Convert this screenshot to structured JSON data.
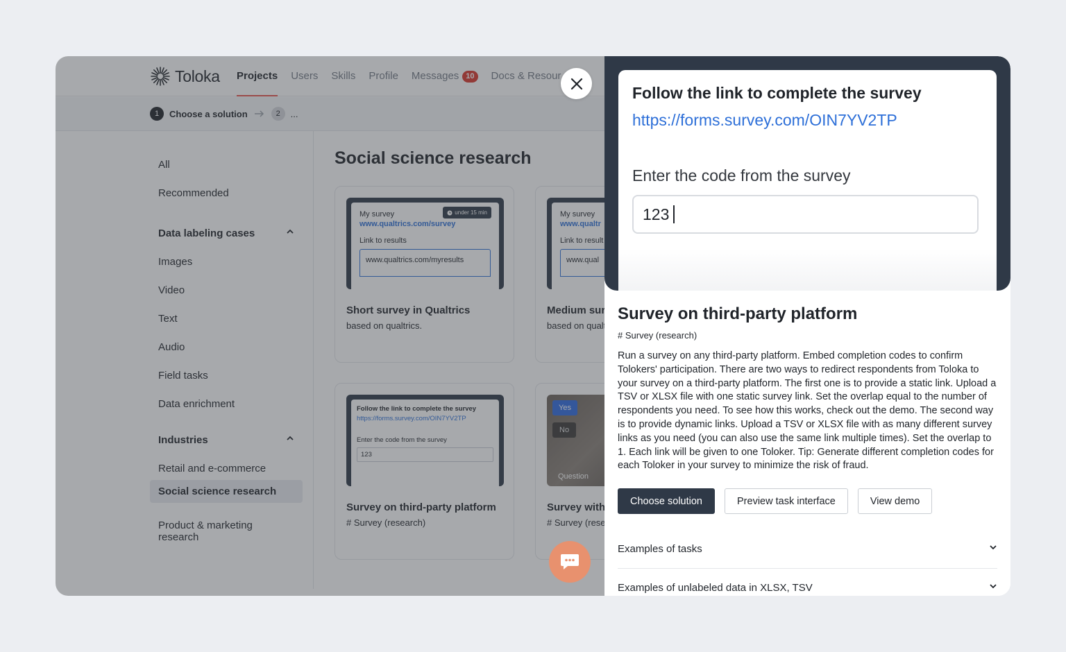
{
  "header": {
    "logo_text": "Toloka",
    "nav": [
      "Projects",
      "Users",
      "Skills",
      "Profile",
      "Messages",
      "Docs & Resour"
    ],
    "messages_badge": "10"
  },
  "steps": {
    "step1_num": "1",
    "step1_label": "Choose a solution",
    "step2_num": "2",
    "step2_label": "..."
  },
  "sidebar": {
    "top_items": [
      "All",
      "Recommended"
    ],
    "section1_title": "Data labeling cases",
    "section1_items": [
      "Images",
      "Video",
      "Text",
      "Audio",
      "Field tasks",
      "Data enrichment"
    ],
    "section2_title": "Industries",
    "section2_items": [
      "Retail and e-commerce",
      "Social science research",
      "Product & marketing research"
    ],
    "selected": "Social science research"
  },
  "main": {
    "title": "Social science research",
    "cards": [
      {
        "title": "Short survey in Qualtrics",
        "sub": "based on qualtrics.",
        "thumb_heading": "My survey",
        "thumb_link": "www.qualtrics.com/survey",
        "thumb_label": "Link to results",
        "thumb_input": "www.qualtrics.com/myresults",
        "thumb_badge": "under 15 min"
      },
      {
        "title": "Medium sur",
        "sub": "based on qualt",
        "thumb_heading": "My survey",
        "thumb_link": "www.qualtr",
        "thumb_label": "Link to result",
        "thumb_input": "www.qual"
      },
      {
        "title": "Survey on third-party platform",
        "sub": "# Survey (research)",
        "thumb_heading": "Follow the link to complete the survey",
        "thumb_link": "https://forms.survey.com/OIN7YV2TP",
        "thumb_label": "Enter the code from the survey",
        "thumb_input": "123"
      },
      {
        "title": "Survey with",
        "sub": "# Survey (rese",
        "thumb_yes": "Yes",
        "thumb_no": "No",
        "thumb_caption": "Question"
      }
    ]
  },
  "panel": {
    "preview_heading": "Follow the link to complete the survey",
    "preview_link": "https://forms.survey.com/OIN7YV2TP",
    "preview_label": "Enter the code from the survey",
    "preview_input": "123",
    "title": "Survey on third-party platform",
    "tag": "# Survey (research)",
    "description": "Run a survey on any third-party platform. Embed completion codes to confirm Tolokers' participation. There are two ways to redirect respondents from Toloka to your survey on a third-party platform. The first one is to provide a static link. Upload a TSV or XLSX file with one static survey link. Set the overlap equal to the number of respondents you need. To see how this works, check out the demo. The second way is to provide dynamic links. Upload a TSV or XLSX file with as many different survey links as you need (you can also use the same link multiple times). Set the overlap to 1. Each link will be given to one Toloker. Tip: Generate different completion codes for each Toloker in your survey to minimize the risk of fraud.",
    "buttons": {
      "choose": "Choose solution",
      "preview": "Preview task interface",
      "demo": "View demo"
    },
    "accordions": [
      "Examples of tasks",
      "Examples of unlabeled data in XLSX, TSV"
    ]
  },
  "colors": {
    "primary": "#2f3947",
    "accent_red": "#d9362b",
    "link_blue": "#2d6fd8",
    "chat_orange": "#e8916e"
  }
}
